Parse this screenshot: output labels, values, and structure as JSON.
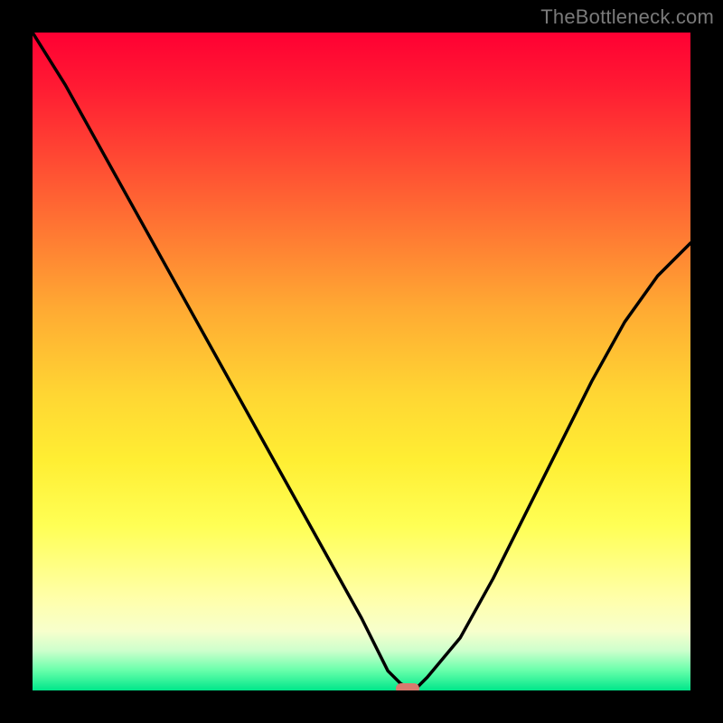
{
  "watermark": "TheBottleneck.com",
  "colors": {
    "frame": "#000000",
    "gradient_top": "#ff0033",
    "gradient_bottom": "#00e68a",
    "curve": "#000000",
    "marker": "#d97a6e",
    "watermark": "#7a7a7a"
  },
  "chart_data": {
    "type": "line",
    "title": "",
    "xlabel": "",
    "ylabel": "",
    "xlim": [
      0,
      100
    ],
    "ylim": [
      0,
      100
    ],
    "grid": false,
    "series": [
      {
        "name": "bottleneck-curve",
        "x": [
          0,
          5,
          10,
          15,
          20,
          25,
          30,
          35,
          40,
          45,
          50,
          54,
          56,
          58,
          60,
          65,
          70,
          75,
          80,
          85,
          90,
          95,
          100
        ],
        "values": [
          100,
          92,
          83,
          74,
          65,
          56,
          47,
          38,
          29,
          20,
          11,
          3,
          1,
          0,
          2,
          8,
          17,
          27,
          37,
          47,
          56,
          63,
          68
        ]
      }
    ],
    "marker": {
      "x": 57,
      "y": 0
    }
  }
}
